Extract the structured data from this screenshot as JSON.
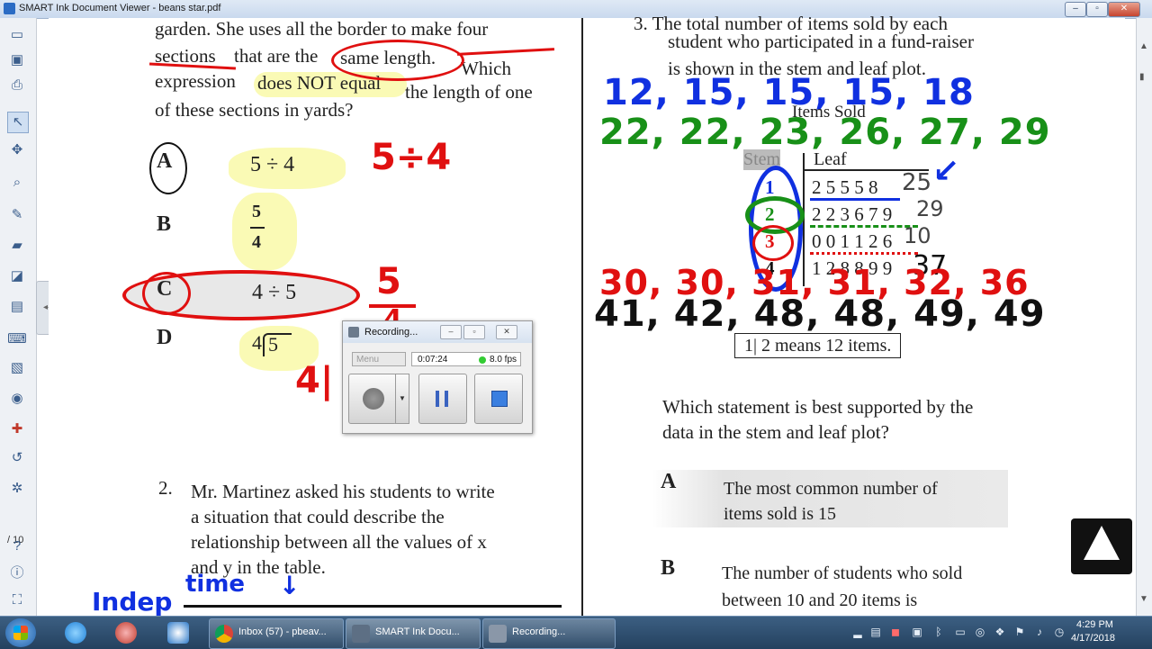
{
  "window": {
    "title": "SMART Ink Document Viewer - beans star.pdf",
    "controls": {
      "minimize": "–",
      "maximize": "▫",
      "close": "✕"
    }
  },
  "left_toolbar": {
    "tools": [
      "cursor-icon",
      "pointer-icon",
      "zoom-icon",
      "pen-icon",
      "highlighter-icon",
      "eraser-icon",
      "fill-icon",
      "page-icon",
      "keyboard-icon",
      "image-icon",
      "camera-icon",
      "add-icon",
      "undo-icon",
      "settings-icon"
    ],
    "page_indicator": "/ 10",
    "help_icons": [
      "help-icon",
      "info-icon",
      "fit-icon"
    ]
  },
  "document": {
    "q1": {
      "line1": "garden. She uses all the border to make four",
      "line2_a": "sections",
      "line2_b": "that are the",
      "line2_c": "same length.",
      "line2_d": "Which",
      "line3_a": "expression",
      "line3_b": "does NOT equal",
      "line3_c": "the length of one",
      "line4": "of these sections in yards?",
      "options": [
        {
          "letter": "A",
          "expr": "5 ÷ 4"
        },
        {
          "letter": "B",
          "num": "5",
          "den": "4"
        },
        {
          "letter": "C",
          "expr": "4 ÷ 5"
        },
        {
          "letter": "D",
          "divisor": "4",
          "dividend": "5"
        }
      ]
    },
    "q2": {
      "number": "2.",
      "lines": [
        "Mr. Martinez asked his students to write",
        "a situation that could describe the",
        "relationship between all the values of x",
        "and y in the table."
      ]
    },
    "q3": {
      "partial_top": "3.  The total number of items sold by each",
      "line1": "student who participated in a fund-raiser",
      "line2": "is shown in the stem and leaf plot.",
      "plot_title": "Items Sold",
      "col_stem": "Stem",
      "col_leaf": "Leaf",
      "rows": [
        {
          "stem": "1",
          "leaves": "2 5 5 5 8"
        },
        {
          "stem": "2",
          "leaves": "2 2 3 6 7 9"
        },
        {
          "stem": "3",
          "leaves": "0 0 1 1 2 6"
        },
        {
          "stem": "4",
          "leaves": "1 2 8 8 9 9"
        }
      ],
      "key": "1| 2 means 12 items.",
      "prompt_line1": "Which statement is best supported by the",
      "prompt_line2": "data in the stem and leaf plot?",
      "choice_a_letter": "A",
      "choice_a_line1": "The most common number of",
      "choice_a_line2": "items sold is 15",
      "choice_b_letter": "B",
      "choice_b_line1": "The number of students who sold",
      "choice_b_line2": "between 10 and 20 items is"
    }
  },
  "annotations": {
    "red_5div4": "5÷4",
    "red_frac_num": "5",
    "red_frac_den": "4",
    "red_4": "4|",
    "blue_row1": "12, 15, 15, 15, 18",
    "green_row2": "22, 22, 23, 26, 27, 29",
    "red_row3": "30, 30, 31, 31, 32, 36",
    "black_row4": "41, 42, 48, 48, 49, 49",
    "blue_leaf_note": "25",
    "green_leaf_note": "29",
    "red_leaf_note": "10",
    "black_leaf_note": "37",
    "bottom_blue": "Indep",
    "bottom_time": "time",
    "colors": {
      "red": "#e01010",
      "blue": "#1030e0",
      "green": "#189018",
      "black": "#111111",
      "highlight": "#f5f578"
    }
  },
  "recorder": {
    "title": "Recording...",
    "menu": "Menu",
    "elapsed": "0:07:24",
    "fps": "8.0 fps",
    "controls": [
      "record-icon",
      "pause-icon",
      "stop-icon"
    ]
  },
  "taskbar": {
    "pinned": [
      "ie-icon",
      "snipping-icon",
      "camera-icon",
      "chrome-icon"
    ],
    "tasks": [
      {
        "label": "Inbox (57) - pbeav...",
        "icon": "chrome-icon"
      },
      {
        "label": "SMART Ink Docu...",
        "icon": "smart-ink-icon"
      },
      {
        "label": "Recording...",
        "icon": "recorder-icon"
      }
    ],
    "clock_time": "4:29 PM",
    "clock_date": "4/17/2018"
  }
}
